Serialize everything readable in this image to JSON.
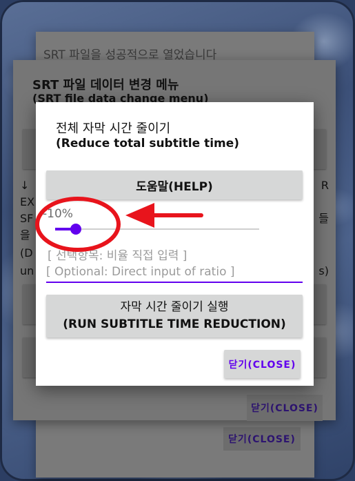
{
  "background_dialog_1": {
    "message": "SRT 파일을 성공적으로 열었습니다",
    "close_label": "닫기(CLOSE)"
  },
  "background_dialog_2": {
    "title_ko": "SRT 파일 데이터 변경 메뉴",
    "title_en": "(SRT file data change menu)",
    "left_fragments": [
      "↓",
      "EX",
      "SF",
      "을",
      "(D",
      "un"
    ],
    "right_fragments": [
      "R",
      "들",
      "s)"
    ],
    "close_label": "닫기(CLOSE)"
  },
  "dialog": {
    "title_ko": "전체 자막 시간 줄이기",
    "title_en": "(Reduce total subtitle time)",
    "help_label": "도움말(HELP)",
    "ratio_value": "-10%",
    "slider_fraction": 0.1,
    "optional_label": "[ 선택항목: 비율 직접 입력 ]",
    "optional_placeholder": "[ Optional: Direct input of ratio ]",
    "run_label_ko": "자막 시간 줄이기 실행",
    "run_label_en": "(RUN SUBTITLE TIME REDUCTION)",
    "close_label": "닫기(CLOSE)"
  },
  "colors": {
    "accent": "#6200ee",
    "annotation": "#e8141c",
    "button_bg": "#d6d7d7"
  }
}
